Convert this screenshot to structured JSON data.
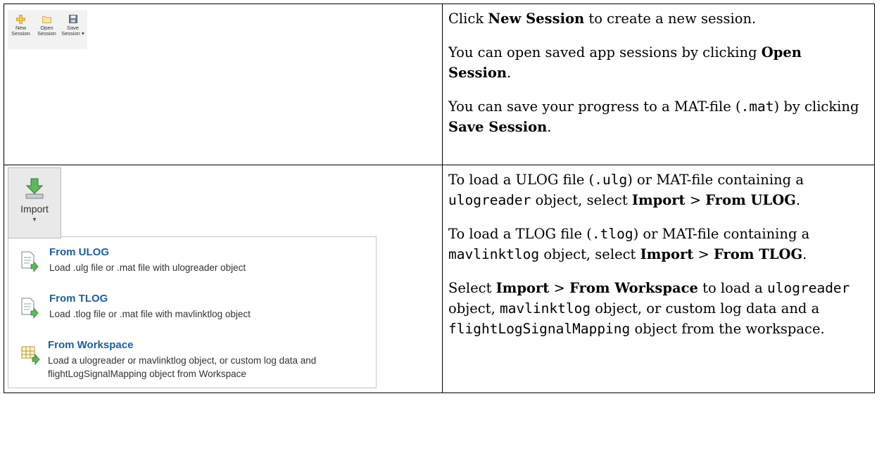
{
  "session_toolbar": {
    "new_session": {
      "line1": "New",
      "line2": "Session"
    },
    "open_session": {
      "line1": "Open",
      "line2": "Session"
    },
    "save_session": {
      "line1": "Save",
      "line2": "Session ▾"
    }
  },
  "import": {
    "button_label": "Import",
    "caret": "▾",
    "menu": [
      {
        "title": "From ULOG",
        "description": "Load .ulg file or .mat file with ulogreader object",
        "icon": "file-import-icon"
      },
      {
        "title": "From TLOG",
        "description": "Load .tlog file or .mat file with mavlinktlog object",
        "icon": "file-import-icon"
      },
      {
        "title": "From Workspace",
        "description": "Load a ulogreader or mavlinktlog object, or custom log data and flightLogSignalMapping object from Workspace",
        "icon": "workspace-import-icon"
      }
    ]
  },
  "session_text": {
    "p1": {
      "a": "Click ",
      "b": "New Session",
      "c": " to create a new session."
    },
    "p2": {
      "a": "You can open saved app sessions by clicking ",
      "b": "Open Session",
      "c": "."
    },
    "p3": {
      "a": "You can save your progress to a MAT-file (",
      "code": ".mat",
      "b": ")",
      "c": " by clicking ",
      "d": "Save Session",
      "e": "."
    }
  },
  "import_text": {
    "p1": {
      "a": "To load a ULOG file (",
      "code1": ".ulg",
      "b": ") or MAT-file containing a ",
      "code2": "ulogreader",
      "c": " object, select ",
      "d": "Import",
      "e": " > ",
      "f": "From ULOG",
      "g": "."
    },
    "p2": {
      "a": "To load a TLOG file (",
      "code1": ".tlog",
      "b": ") or MAT-file containing a ",
      "code2": "mavlinktlog",
      "c": " object, select ",
      "d": "Import",
      "e": " > ",
      "f": "From TLOG",
      "g": "."
    },
    "p3": {
      "a": "Select ",
      "b": "Import",
      "c": " > ",
      "d": "From Workspace",
      "e": " to load a ",
      "code1": "ulogreader",
      "f": " object, ",
      "code2": "mavlinktlog",
      "g": " object, or custom log data and a ",
      "code3": "flightLogSignalMapping",
      "h": " object from the workspace."
    }
  },
  "colors": {
    "link_blue": "#1a5ea8",
    "icon_green": "#3aa33a",
    "border": "#000000"
  }
}
